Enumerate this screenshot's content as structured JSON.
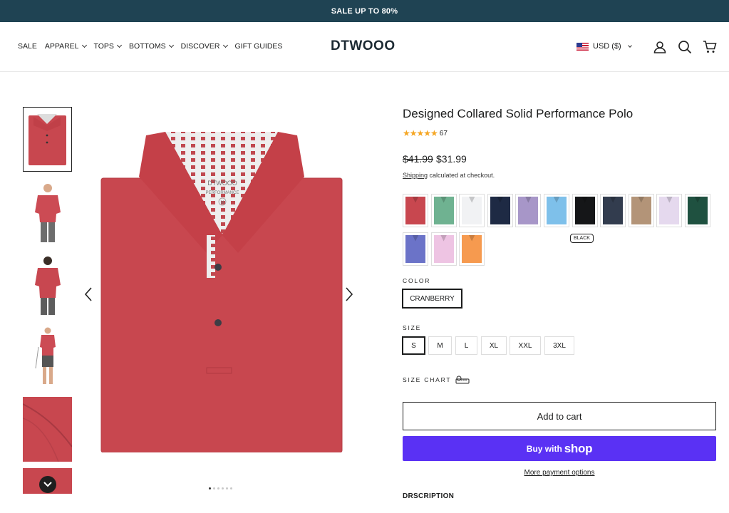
{
  "announcement": {
    "text": "SALE UP TO 80%"
  },
  "header": {
    "nav": [
      {
        "label": "SALE",
        "dropdown": false
      },
      {
        "label": "APPAREL",
        "dropdown": true
      },
      {
        "label": "TOPS",
        "dropdown": true
      },
      {
        "label": "BOTTOMS",
        "dropdown": true
      },
      {
        "label": "DISCOVER",
        "dropdown": true
      },
      {
        "label": "GIFT GUIDES",
        "dropdown": false
      }
    ],
    "logo": "DTWOOO",
    "currency": "USD ($)",
    "icons": [
      "account-icon",
      "search-icon",
      "cart-icon"
    ]
  },
  "gallery": {
    "thumbnails": [
      "polo-folded",
      "model-front",
      "model-back",
      "model-full",
      "fabric-closeup",
      "detail"
    ],
    "active_index": 0,
    "main_image_label": "DTWOOO",
    "main_image_sublabel": "PERFORMANCE",
    "main_image_size_tag": "M",
    "pagination_count": 6,
    "pagination_active": 0
  },
  "product": {
    "title": "Designed Collared Solid Performance Polo",
    "rating": 4.5,
    "review_count": "67",
    "price_old": "$41.99",
    "price_new": "$31.99",
    "shipping_link": "Shipping",
    "shipping_text": " calculated at checkout.",
    "swatches": [
      {
        "name": "cranberry",
        "color": "#c8474f"
      },
      {
        "name": "sage",
        "color": "#6fb291"
      },
      {
        "name": "white",
        "color": "#f1f2f4"
      },
      {
        "name": "navy",
        "color": "#1e2a44"
      },
      {
        "name": "lavender",
        "color": "#a796c8"
      },
      {
        "name": "sky",
        "color": "#7ec0ea"
      },
      {
        "name": "black",
        "color": "#151618"
      },
      {
        "name": "slate",
        "color": "#323c4e"
      },
      {
        "name": "khaki",
        "color": "#b39478"
      },
      {
        "name": "lilac",
        "color": "#e5d9ee"
      },
      {
        "name": "forest",
        "color": "#1f5140"
      },
      {
        "name": "periwinkle",
        "color": "#6b73c8"
      },
      {
        "name": "pink",
        "color": "#eec4e3"
      },
      {
        "name": "orange",
        "color": "#f69a4f"
      }
    ],
    "tooltip": "BLACK",
    "color_label": "COLOR",
    "color_value": "CRANBERRY",
    "size_label": "SIZE",
    "sizes": [
      "S",
      "M",
      "L",
      "XL",
      "XXL",
      "3XL"
    ],
    "selected_size": "S",
    "size_chart": "SIZE CHART",
    "add_to_cart": "Add to cart",
    "buy_with": "Buy with",
    "shop": "shop",
    "more_payment": "More payment options",
    "description_heading": "DRSCRIPTION"
  }
}
